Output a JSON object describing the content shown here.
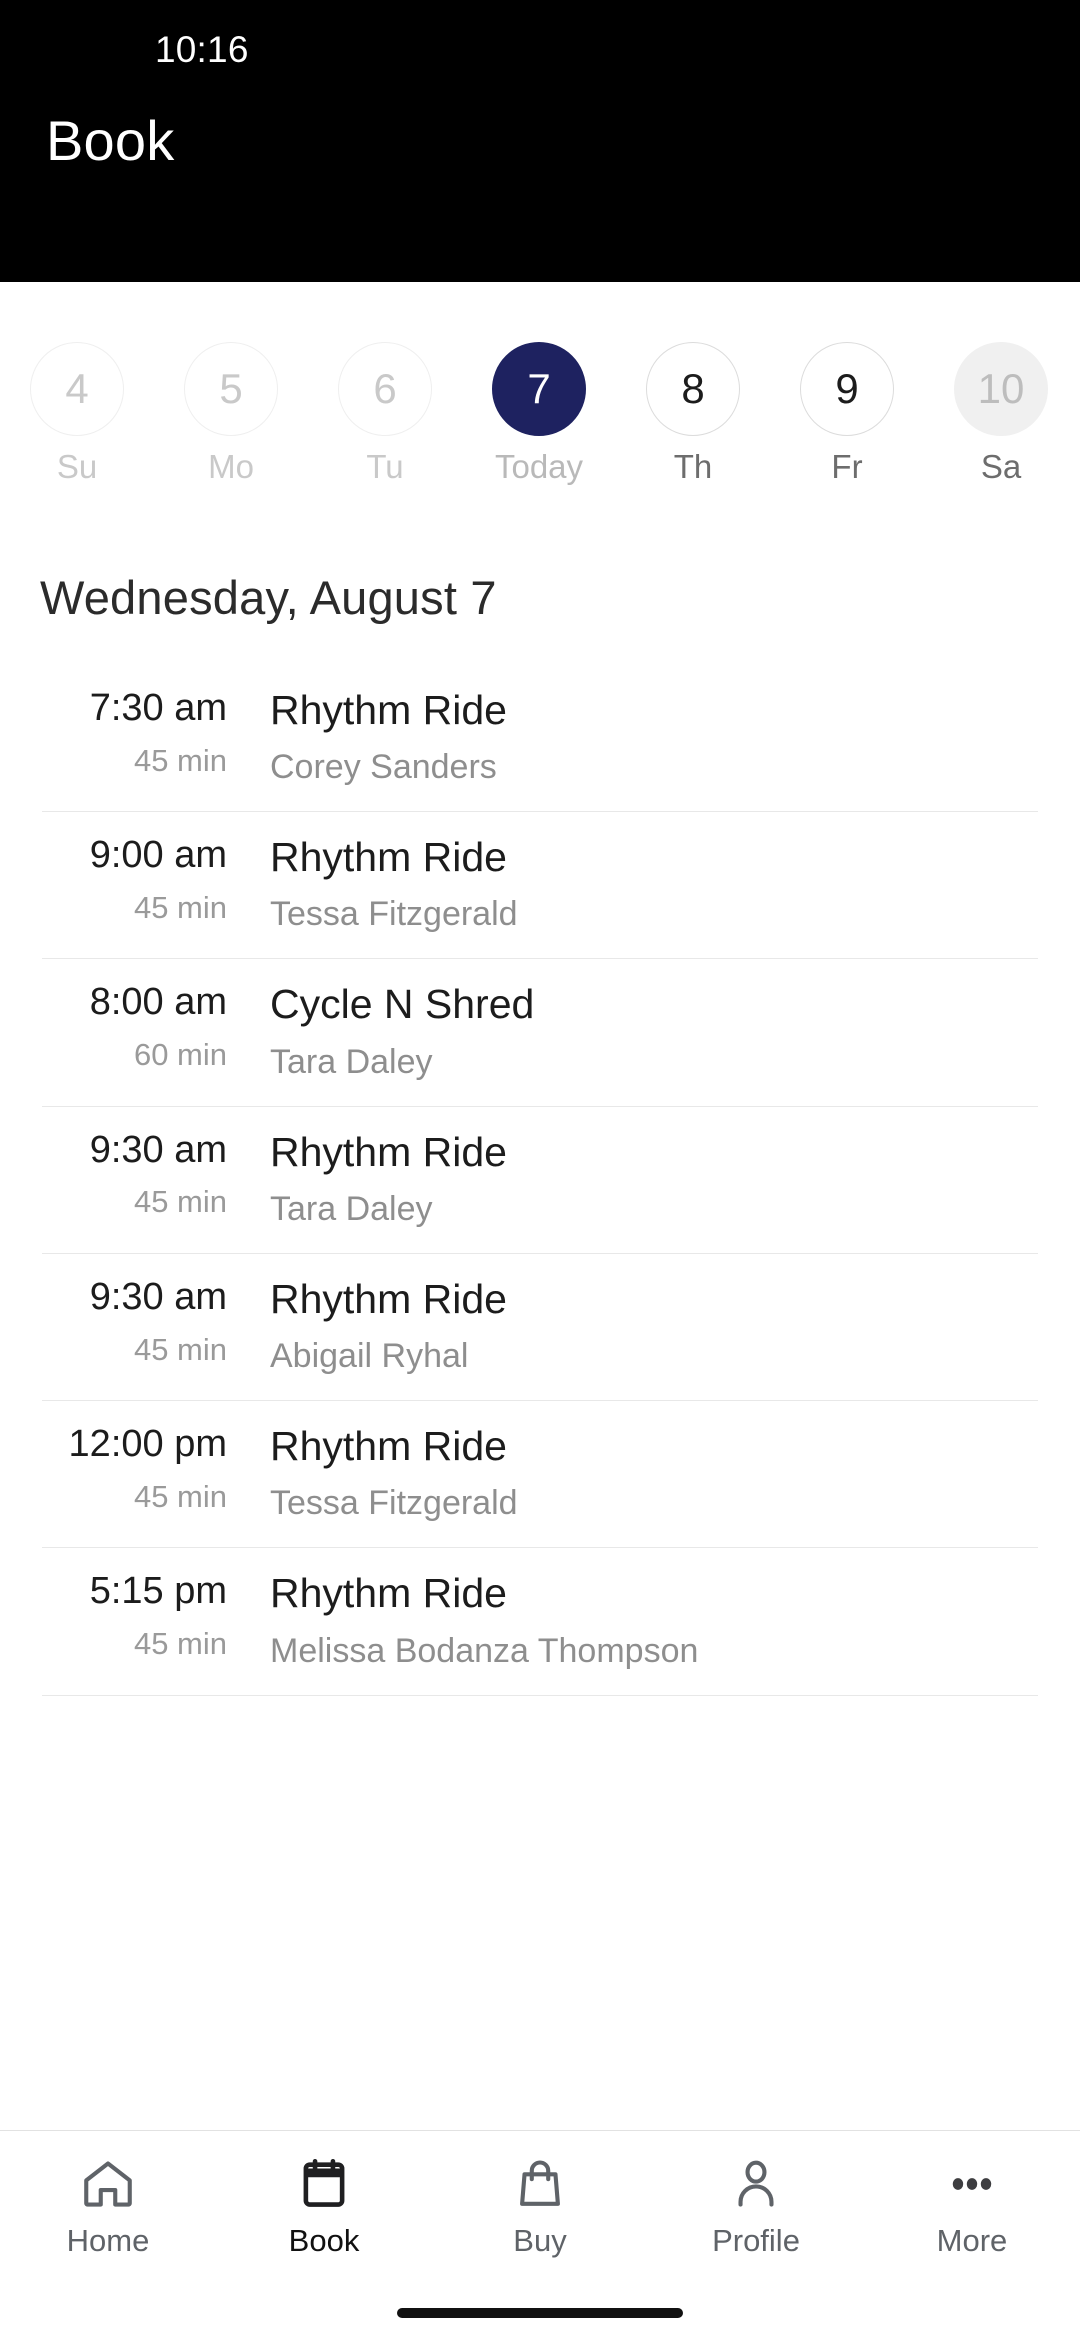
{
  "status_bar": {
    "time": "10:16"
  },
  "header": {
    "title": "Book"
  },
  "date_strip": {
    "days": [
      {
        "num": "4",
        "label": "Su",
        "state": "past"
      },
      {
        "num": "5",
        "label": "Mo",
        "state": "past"
      },
      {
        "num": "6",
        "label": "Tu",
        "state": "past"
      },
      {
        "num": "7",
        "label": "Today",
        "state": "selected"
      },
      {
        "num": "8",
        "label": "Th",
        "state": "default"
      },
      {
        "num": "9",
        "label": "Fr",
        "state": "default"
      },
      {
        "num": "10",
        "label": "Sa",
        "state": "muted"
      }
    ]
  },
  "schedule": {
    "date_heading": "Wednesday, August 7",
    "classes": [
      {
        "time": "7:30 am",
        "duration": "45 min",
        "name": "Rhythm Ride",
        "instructor": "Corey Sanders"
      },
      {
        "time": "9:00 am",
        "duration": "45 min",
        "name": "Rhythm Ride",
        "instructor": "Tessa Fitzgerald"
      },
      {
        "time": "8:00 am",
        "duration": "60 min",
        "name": "Cycle N Shred",
        "instructor": "Tara Daley"
      },
      {
        "time": "9:30 am",
        "duration": "45 min",
        "name": "Rhythm Ride",
        "instructor": "Tara Daley"
      },
      {
        "time": "9:30 am",
        "duration": "45 min",
        "name": "Rhythm Ride",
        "instructor": "Abigail Ryhal"
      },
      {
        "time": "12:00 pm",
        "duration": "45 min",
        "name": "Rhythm Ride",
        "instructor": "Tessa Fitzgerald"
      },
      {
        "time": "5:15 pm",
        "duration": "45 min",
        "name": "Rhythm Ride",
        "instructor": "Melissa Bodanza Thompson"
      }
    ]
  },
  "bottom_nav": {
    "items": [
      {
        "label": "Home",
        "icon": "home-icon",
        "active": false
      },
      {
        "label": "Book",
        "icon": "calendar-icon",
        "active": true
      },
      {
        "label": "Buy",
        "icon": "shopping-bag-icon",
        "active": false
      },
      {
        "label": "Profile",
        "icon": "person-icon",
        "active": false
      },
      {
        "label": "More",
        "icon": "ellipsis-icon",
        "active": false
      }
    ]
  },
  "colors": {
    "accent_navy": "#1e2260",
    "header_bg": "#000000",
    "text_primary": "#1c1c1c",
    "text_secondary": "#8e8e8e",
    "divider": "#e8e8e8"
  }
}
